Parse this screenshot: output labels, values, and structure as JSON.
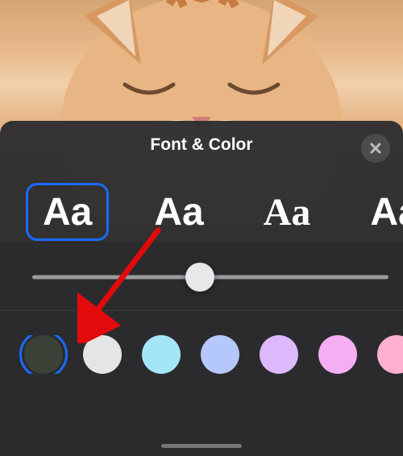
{
  "sheet": {
    "title": "Font & Color"
  },
  "fonts": [
    {
      "sample": "Aa",
      "family": "sans",
      "selected": true
    },
    {
      "sample": "Aa",
      "family": "sans2",
      "selected": false
    },
    {
      "sample": "Aa",
      "family": "serif",
      "selected": false
    },
    {
      "sample": "Aa",
      "family": "sans3",
      "selected": false
    }
  ],
  "slider": {
    "value": 0.47
  },
  "colors": [
    {
      "hex": "#3a4238",
      "selected": true
    },
    {
      "hex": "#e5e5e5",
      "selected": false
    },
    {
      "hex": "#a4e6f8",
      "selected": false
    },
    {
      "hex": "#b4c8fb",
      "selected": false
    },
    {
      "hex": "#dcb9fa",
      "selected": false
    },
    {
      "hex": "#f5aef3",
      "selected": false
    },
    {
      "hex": "#ffb0d1",
      "selected": false
    }
  ],
  "annotation": {
    "target": "first-color-swatch"
  }
}
